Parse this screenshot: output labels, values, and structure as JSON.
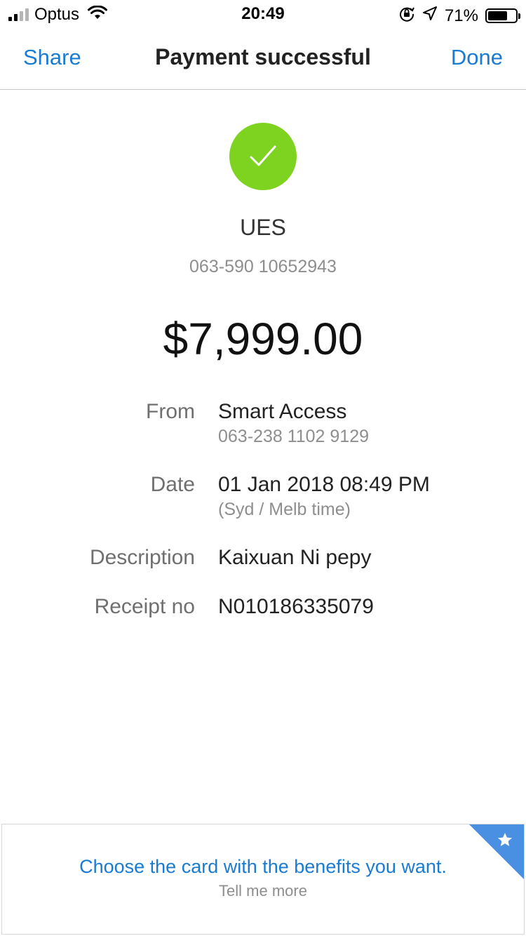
{
  "status_bar": {
    "carrier": "Optus",
    "time": "20:49",
    "battery_percent": "71%",
    "battery_level": 0.71,
    "icons": [
      "signal-icon",
      "wifi-icon",
      "orientation-lock-icon",
      "location-icon",
      "battery-icon"
    ]
  },
  "nav": {
    "share_label": "Share",
    "title": "Payment successful",
    "done_label": "Done"
  },
  "payee": {
    "name": "UES",
    "account": "063-590 10652943"
  },
  "amount": "$7,999.00",
  "details": {
    "from": {
      "label": "From",
      "value": "Smart Access",
      "sub": "063-238 1102 9129"
    },
    "date": {
      "label": "Date",
      "value": "01 Jan 2018 08:49 PM",
      "sub": "(Syd / Melb time)"
    },
    "description": {
      "label": "Description",
      "value": "Kaixuan Ni pepy"
    },
    "receipt": {
      "label": "Receipt no",
      "value": "N010186335079"
    }
  },
  "promo": {
    "title": "Choose the card with the benefits you want.",
    "link": "Tell me more"
  },
  "colors": {
    "accent_blue": "#1a7bd3",
    "success_green": "#7ed321",
    "corner_blue": "#4a90e2"
  }
}
